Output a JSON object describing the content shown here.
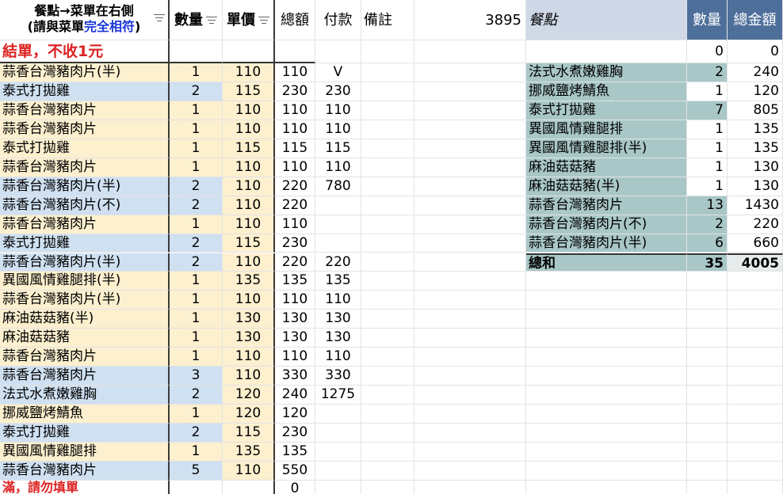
{
  "header": {
    "dish_line1": "餐點→菜單在右側",
    "dish_line2_prefix": "(請與菜單",
    "dish_line2_blue": "完全相符",
    "dish_line2_suffix": ")",
    "qty": "數量",
    "price": "單價",
    "total": "總額",
    "paid": "付款",
    "note": "備註",
    "sum_value": "3895",
    "menu_dish": "餐點",
    "menu_qty": "數量",
    "menu_total": "總金額"
  },
  "notice": {
    "text": "結單，不收1元",
    "menu_qty": "0",
    "menu_total": "0"
  },
  "orders": [
    {
      "dish": "蒜香台灣豬肉片(半)",
      "qty": "1",
      "price": "110",
      "total": "110",
      "paid": "V",
      "color": "y"
    },
    {
      "dish": "泰式打拋雞",
      "qty": "2",
      "price": "115",
      "total": "230",
      "paid": "230",
      "color": "b"
    },
    {
      "dish": "蒜香台灣豬肉片",
      "qty": "1",
      "price": "110",
      "total": "110",
      "paid": "110",
      "color": "y"
    },
    {
      "dish": "蒜香台灣豬肉片",
      "qty": "1",
      "price": "110",
      "total": "110",
      "paid": "110",
      "color": "y"
    },
    {
      "dish": "泰式打拋雞",
      "qty": "1",
      "price": "115",
      "total": "115",
      "paid": "115",
      "color": "y"
    },
    {
      "dish": "蒜香台灣豬肉片",
      "qty": "1",
      "price": "110",
      "total": "110",
      "paid": "110",
      "color": "y"
    },
    {
      "dish": "蒜香台灣豬肉片(半)",
      "qty": "2",
      "price": "110",
      "total": "220",
      "paid": "780",
      "color": "b"
    },
    {
      "dish": "蒜香台灣豬肉片(不)",
      "qty": "2",
      "price": "110",
      "total": "220",
      "paid": "",
      "color": "b"
    },
    {
      "dish": "蒜香台灣豬肉片",
      "qty": "1",
      "price": "110",
      "total": "110",
      "paid": "",
      "color": "y"
    },
    {
      "dish": "泰式打拋雞",
      "qty": "2",
      "price": "115",
      "total": "230",
      "paid": "",
      "color": "b"
    },
    {
      "dish": "蒜香台灣豬肉片(半)",
      "qty": "2",
      "price": "110",
      "total": "220",
      "paid": "220",
      "color": "b"
    },
    {
      "dish": "異國風情雞腿排(半)",
      "qty": "1",
      "price": "135",
      "total": "135",
      "paid": "135",
      "color": "y"
    },
    {
      "dish": "蒜香台灣豬肉片(半)",
      "qty": "1",
      "price": "110",
      "total": "110",
      "paid": "110",
      "color": "y"
    },
    {
      "dish": "麻油菇菇豬(半)",
      "qty": "1",
      "price": "130",
      "total": "130",
      "paid": "130",
      "color": "y"
    },
    {
      "dish": "麻油菇菇豬",
      "qty": "1",
      "price": "130",
      "total": "130",
      "paid": "130",
      "color": "y"
    },
    {
      "dish": "蒜香台灣豬肉片",
      "qty": "1",
      "price": "110",
      "total": "110",
      "paid": "110",
      "color": "y"
    },
    {
      "dish": "蒜香台灣豬肉片",
      "qty": "3",
      "price": "110",
      "total": "330",
      "paid": "330",
      "color": "b"
    },
    {
      "dish": "法式水煮嫩雞胸",
      "qty": "2",
      "price": "120",
      "total": "240",
      "paid": "1275",
      "color": "b"
    },
    {
      "dish": "挪威鹽烤鯖魚",
      "qty": "1",
      "price": "120",
      "total": "120",
      "paid": "",
      "color": "y"
    },
    {
      "dish": "泰式打拋雞",
      "qty": "2",
      "price": "115",
      "total": "230",
      "paid": "",
      "color": "b"
    },
    {
      "dish": "異國風情雞腿排",
      "qty": "1",
      "price": "135",
      "total": "135",
      "paid": "",
      "color": "y"
    },
    {
      "dish": "蒜香台灣豬肉片",
      "qty": "5",
      "price": "110",
      "total": "550",
      "paid": "",
      "color": "b"
    }
  ],
  "footer": {
    "partial_text": "滿，請勿填單",
    "total": "0"
  },
  "menu": [
    {
      "dish": "法式水煮嫩雞胸",
      "qty": "2",
      "total": "240",
      "hl": true
    },
    {
      "dish": "挪威鹽烤鯖魚",
      "qty": "1",
      "total": "120",
      "hl": false
    },
    {
      "dish": "泰式打拋雞",
      "qty": "7",
      "total": "805",
      "hl": true
    },
    {
      "dish": "異國風情雞腿排",
      "qty": "1",
      "total": "135",
      "hl": false
    },
    {
      "dish": "異國風情雞腿排(半)",
      "qty": "1",
      "total": "135",
      "hl": false
    },
    {
      "dish": "麻油菇菇豬",
      "qty": "1",
      "total": "130",
      "hl": false
    },
    {
      "dish": "麻油菇菇豬(半)",
      "qty": "1",
      "total": "130",
      "hl": false
    },
    {
      "dish": "蒜香台灣豬肉片",
      "qty": "13",
      "total": "1430",
      "hl": true
    },
    {
      "dish": "蒜香台灣豬肉片(不)",
      "qty": "2",
      "total": "220",
      "hl": true
    },
    {
      "dish": "蒜香台灣豬肉片(半)",
      "qty": "6",
      "total": "660",
      "hl": true
    }
  ],
  "menu_total": {
    "label": "總和",
    "qty": "35",
    "total": "4005"
  },
  "colors": {
    "yellow": "#fdf0cf",
    "blue": "#cfe0f1",
    "teal": "#a9c7c7",
    "red": "#dd2222",
    "header_blue": "#4f6f9b"
  }
}
